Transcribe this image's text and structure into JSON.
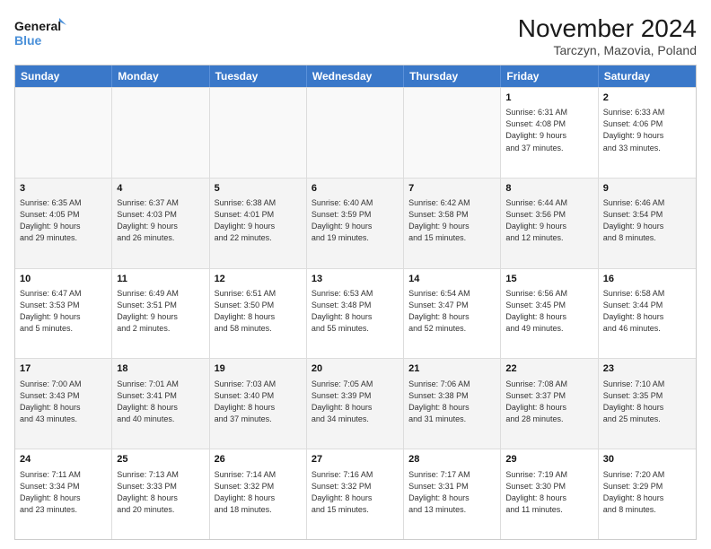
{
  "logo": {
    "line1": "General",
    "line2": "Blue"
  },
  "title": "November 2024",
  "subtitle": "Tarczyn, Mazovia, Poland",
  "header_days": [
    "Sunday",
    "Monday",
    "Tuesday",
    "Wednesday",
    "Thursday",
    "Friday",
    "Saturday"
  ],
  "rows": [
    [
      {
        "day": "",
        "info": ""
      },
      {
        "day": "",
        "info": ""
      },
      {
        "day": "",
        "info": ""
      },
      {
        "day": "",
        "info": ""
      },
      {
        "day": "",
        "info": ""
      },
      {
        "day": "1",
        "info": "Sunrise: 6:31 AM\nSunset: 4:08 PM\nDaylight: 9 hours\nand 37 minutes."
      },
      {
        "day": "2",
        "info": "Sunrise: 6:33 AM\nSunset: 4:06 PM\nDaylight: 9 hours\nand 33 minutes."
      }
    ],
    [
      {
        "day": "3",
        "info": "Sunrise: 6:35 AM\nSunset: 4:05 PM\nDaylight: 9 hours\nand 29 minutes."
      },
      {
        "day": "4",
        "info": "Sunrise: 6:37 AM\nSunset: 4:03 PM\nDaylight: 9 hours\nand 26 minutes."
      },
      {
        "day": "5",
        "info": "Sunrise: 6:38 AM\nSunset: 4:01 PM\nDaylight: 9 hours\nand 22 minutes."
      },
      {
        "day": "6",
        "info": "Sunrise: 6:40 AM\nSunset: 3:59 PM\nDaylight: 9 hours\nand 19 minutes."
      },
      {
        "day": "7",
        "info": "Sunrise: 6:42 AM\nSunset: 3:58 PM\nDaylight: 9 hours\nand 15 minutes."
      },
      {
        "day": "8",
        "info": "Sunrise: 6:44 AM\nSunset: 3:56 PM\nDaylight: 9 hours\nand 12 minutes."
      },
      {
        "day": "9",
        "info": "Sunrise: 6:46 AM\nSunset: 3:54 PM\nDaylight: 9 hours\nand 8 minutes."
      }
    ],
    [
      {
        "day": "10",
        "info": "Sunrise: 6:47 AM\nSunset: 3:53 PM\nDaylight: 9 hours\nand 5 minutes."
      },
      {
        "day": "11",
        "info": "Sunrise: 6:49 AM\nSunset: 3:51 PM\nDaylight: 9 hours\nand 2 minutes."
      },
      {
        "day": "12",
        "info": "Sunrise: 6:51 AM\nSunset: 3:50 PM\nDaylight: 8 hours\nand 58 minutes."
      },
      {
        "day": "13",
        "info": "Sunrise: 6:53 AM\nSunset: 3:48 PM\nDaylight: 8 hours\nand 55 minutes."
      },
      {
        "day": "14",
        "info": "Sunrise: 6:54 AM\nSunset: 3:47 PM\nDaylight: 8 hours\nand 52 minutes."
      },
      {
        "day": "15",
        "info": "Sunrise: 6:56 AM\nSunset: 3:45 PM\nDaylight: 8 hours\nand 49 minutes."
      },
      {
        "day": "16",
        "info": "Sunrise: 6:58 AM\nSunset: 3:44 PM\nDaylight: 8 hours\nand 46 minutes."
      }
    ],
    [
      {
        "day": "17",
        "info": "Sunrise: 7:00 AM\nSunset: 3:43 PM\nDaylight: 8 hours\nand 43 minutes."
      },
      {
        "day": "18",
        "info": "Sunrise: 7:01 AM\nSunset: 3:41 PM\nDaylight: 8 hours\nand 40 minutes."
      },
      {
        "day": "19",
        "info": "Sunrise: 7:03 AM\nSunset: 3:40 PM\nDaylight: 8 hours\nand 37 minutes."
      },
      {
        "day": "20",
        "info": "Sunrise: 7:05 AM\nSunset: 3:39 PM\nDaylight: 8 hours\nand 34 minutes."
      },
      {
        "day": "21",
        "info": "Sunrise: 7:06 AM\nSunset: 3:38 PM\nDaylight: 8 hours\nand 31 minutes."
      },
      {
        "day": "22",
        "info": "Sunrise: 7:08 AM\nSunset: 3:37 PM\nDaylight: 8 hours\nand 28 minutes."
      },
      {
        "day": "23",
        "info": "Sunrise: 7:10 AM\nSunset: 3:35 PM\nDaylight: 8 hours\nand 25 minutes."
      }
    ],
    [
      {
        "day": "24",
        "info": "Sunrise: 7:11 AM\nSunset: 3:34 PM\nDaylight: 8 hours\nand 23 minutes."
      },
      {
        "day": "25",
        "info": "Sunrise: 7:13 AM\nSunset: 3:33 PM\nDaylight: 8 hours\nand 20 minutes."
      },
      {
        "day": "26",
        "info": "Sunrise: 7:14 AM\nSunset: 3:32 PM\nDaylight: 8 hours\nand 18 minutes."
      },
      {
        "day": "27",
        "info": "Sunrise: 7:16 AM\nSunset: 3:32 PM\nDaylight: 8 hours\nand 15 minutes."
      },
      {
        "day": "28",
        "info": "Sunrise: 7:17 AM\nSunset: 3:31 PM\nDaylight: 8 hours\nand 13 minutes."
      },
      {
        "day": "29",
        "info": "Sunrise: 7:19 AM\nSunset: 3:30 PM\nDaylight: 8 hours\nand 11 minutes."
      },
      {
        "day": "30",
        "info": "Sunrise: 7:20 AM\nSunset: 3:29 PM\nDaylight: 8 hours\nand 8 minutes."
      }
    ]
  ]
}
